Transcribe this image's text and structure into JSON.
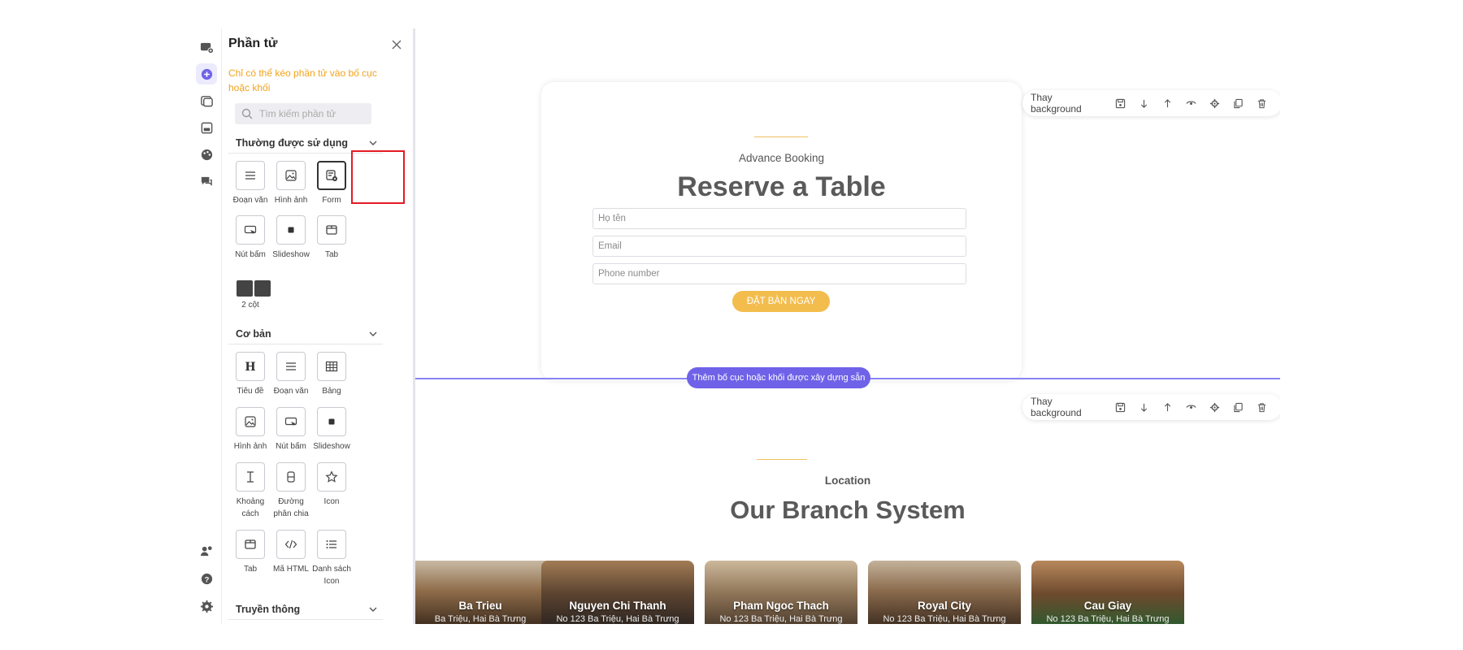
{
  "panel": {
    "title": "Phần tử",
    "hint": "Chỉ có thể kéo phần tử vào bố cục hoặc khối",
    "search_placeholder": "Tìm kiếm phần tử",
    "sections": {
      "common": {
        "title": "Thường được sử dụng",
        "items": [
          "Đoạn văn",
          "Hình ảnh",
          "Form",
          "Nút bấm",
          "Slideshow",
          "Tab",
          "2 cột"
        ]
      },
      "basic": {
        "title": "Cơ bản",
        "items": [
          "Tiêu đề",
          "Đoạn văn",
          "Bảng",
          "Hình ảnh",
          "Nút bấm",
          "Slideshow",
          "Khoảng cách",
          "Đường phân chia",
          "Icon",
          "Tab",
          "Mã HTML",
          "Danh sách Icon"
        ]
      },
      "media": {
        "title": "Truyền thông"
      }
    }
  },
  "toolbar": {
    "label": "Thay background"
  },
  "booking": {
    "overline": "Advance Booking",
    "title": "Reserve a Table",
    "name_placeholder": "Họ tên",
    "email_placeholder": "Email",
    "phone_placeholder": "Phone number",
    "button": "ĐẶT BÀN NGAY"
  },
  "add_layout_label": "Thêm bố cục hoặc khối được xây dựng sẵn",
  "location": {
    "overline": "Location",
    "title": "Our Branch System",
    "branches": [
      {
        "name": "Ba Trieu",
        "addr": "Ba Triệu, Hai Bà Trưng"
      },
      {
        "name": "Nguyen Chi Thanh",
        "addr": "No 123 Ba Triệu, Hai Bà Trưng"
      },
      {
        "name": "Pham Ngoc Thach",
        "addr": "No 123 Ba Triệu, Hai Bà Trưng"
      },
      {
        "name": "Royal City",
        "addr": "No 123 Ba Triệu, Hai Bà Trưng"
      },
      {
        "name": "Cau Giay",
        "addr": "No 123 Ba Triệu, Hai Bà Trưng"
      }
    ]
  },
  "colors": {
    "accent": "#6f62e8",
    "gold": "#f3bd4d",
    "hint": "#f2a31c",
    "highlight": "#e31b23"
  }
}
